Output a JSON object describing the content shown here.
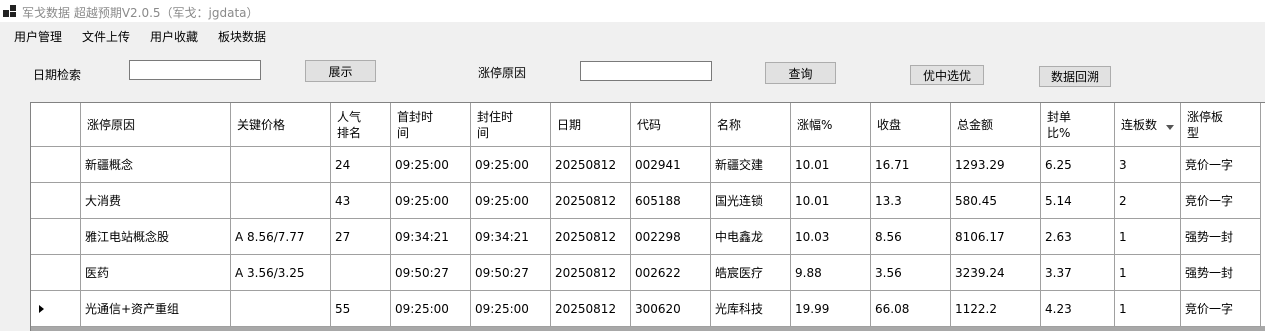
{
  "window": {
    "title": "军戈数据 超越预期V2.0.5（军戈：jgdata）"
  },
  "menu": [
    "用户管理",
    "文件上传",
    "用户收藏",
    "板块数据"
  ],
  "toolbar": {
    "date_label": "日期检索",
    "date_value": "",
    "show_button": "展示",
    "reason_label": "涨停原因",
    "reason_value": "",
    "query_button": "查询",
    "select_button": "优中选优",
    "backtest_button": "数据回溯"
  },
  "table": {
    "columns": [
      "涨停原因",
      "关键价格",
      "人气\n排名",
      "首封时\n间",
      "封住时\n间",
      "日期",
      "代码",
      "名称",
      "涨幅%",
      "收盘",
      "总金额",
      "封单\n比%",
      "连板数",
      "涨停板\n型"
    ],
    "sorted_column": "连板数",
    "current_row": 4,
    "rows": [
      [
        "新疆概念",
        "",
        "24",
        "09:25:00",
        "09:25:00",
        "20250812",
        "002941",
        "新疆交建",
        "10.01",
        "16.71",
        "1293.29",
        "6.25",
        "3",
        "竞价一字"
      ],
      [
        "大消费",
        "",
        "43",
        "09:25:00",
        "09:25:00",
        "20250812",
        "605188",
        "国光连锁",
        "10.01",
        "13.3",
        "580.45",
        "5.14",
        "2",
        "竞价一字"
      ],
      [
        "雅江电站概念股",
        "A 8.56/7.77",
        "27",
        "09:34:21",
        "09:34:21",
        "20250812",
        "002298",
        "中电鑫龙",
        "10.03",
        "8.56",
        "8106.17",
        "2.63",
        "1",
        "强势一封"
      ],
      [
        "医药",
        "A 3.56/3.25",
        "",
        "09:50:27",
        "09:50:27",
        "20250812",
        "002622",
        "皓宸医疗",
        "9.88",
        "3.56",
        "3239.24",
        "3.37",
        "1",
        "强势一封"
      ],
      [
        "光通信+资产重组",
        "",
        "55",
        "09:25:00",
        "09:25:00",
        "20250812",
        "300620",
        "光库科技",
        "19.99",
        "66.08",
        "1122.2",
        "4.23",
        "1",
        "竞价一字"
      ]
    ]
  }
}
